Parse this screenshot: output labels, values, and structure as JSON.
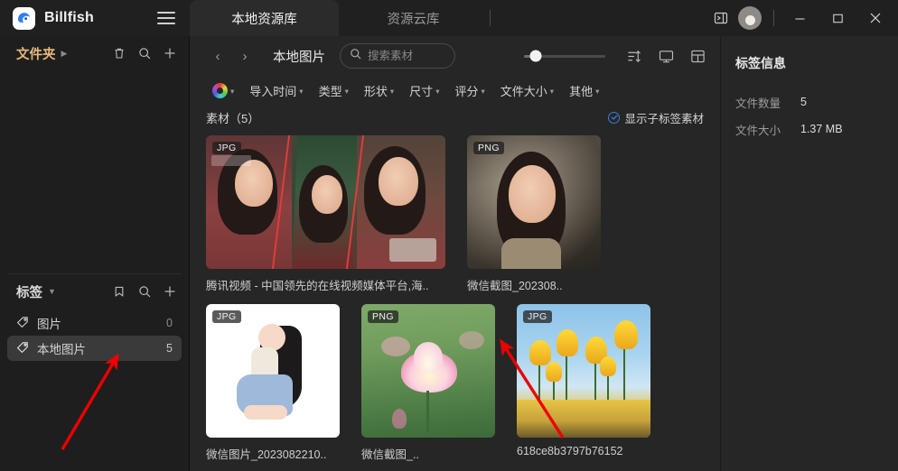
{
  "app": {
    "brand": "Billfish",
    "menu_icon": "hamburger-icon"
  },
  "tabs": [
    {
      "label": "本地资源库",
      "active": true
    },
    {
      "label": "资源云库",
      "active": false
    }
  ],
  "window_controls": {
    "panel_toggle": "panel-toggle-icon",
    "minimize": "—",
    "maximize": "▢",
    "close": "✕"
  },
  "sidebar": {
    "folders": {
      "title": "文件夹",
      "actions": [
        "trash-icon",
        "search-icon",
        "plus-icon"
      ]
    },
    "tags": {
      "title": "标签",
      "actions": [
        "bookmark-icon",
        "search-icon",
        "plus-icon"
      ],
      "items": [
        {
          "label": "图片",
          "count": "0",
          "selected": false
        },
        {
          "label": "本地图片",
          "count": "5",
          "selected": true
        }
      ]
    }
  },
  "toolbar": {
    "back": "‹",
    "forward": "›",
    "breadcrumb": "本地图片",
    "search_placeholder": "搜索素材",
    "search_value": "",
    "zoom_percent": 14,
    "view_icons": [
      "sort-icon",
      "display-icon",
      "grid-layout-icon"
    ]
  },
  "filters": [
    {
      "label": "导入时间"
    },
    {
      "label": "类型"
    },
    {
      "label": "形状"
    },
    {
      "label": "尺寸"
    },
    {
      "label": "评分"
    },
    {
      "label": "文件大小"
    },
    {
      "label": "其他"
    }
  ],
  "content": {
    "count_label": "素材（5）",
    "subtag_label": "显示子标签素材",
    "items": [
      {
        "badge": "JPG",
        "name": "腾讯视频 - 中国领先的在线视频媒体平台,海..",
        "art": "tv-show",
        "wide": true
      },
      {
        "badge": "PNG",
        "name": "微信截图_202308..",
        "art": "portrait-old",
        "wide": false
      },
      {
        "badge": "JPG",
        "name": "微信图片_2023082210..",
        "art": "ill-white",
        "wide": false
      },
      {
        "badge": "PNG",
        "name": "微信截图_..",
        "art": "lotus",
        "wide": false
      },
      {
        "badge": "JPG",
        "name": "618ce8b3797b76152",
        "art": "tulips",
        "wide": false
      }
    ]
  },
  "right_panel": {
    "title": "标签信息",
    "rows": [
      {
        "key": "文件数量",
        "value": "5"
      },
      {
        "key": "文件大小",
        "value": "1.37 MB"
      }
    ]
  },
  "colors": {
    "accent_blue": "#3b7ddd",
    "folder_title": "#e4b97a",
    "annotation_red": "#ee0000",
    "window_bg": "#1c1c1c"
  }
}
